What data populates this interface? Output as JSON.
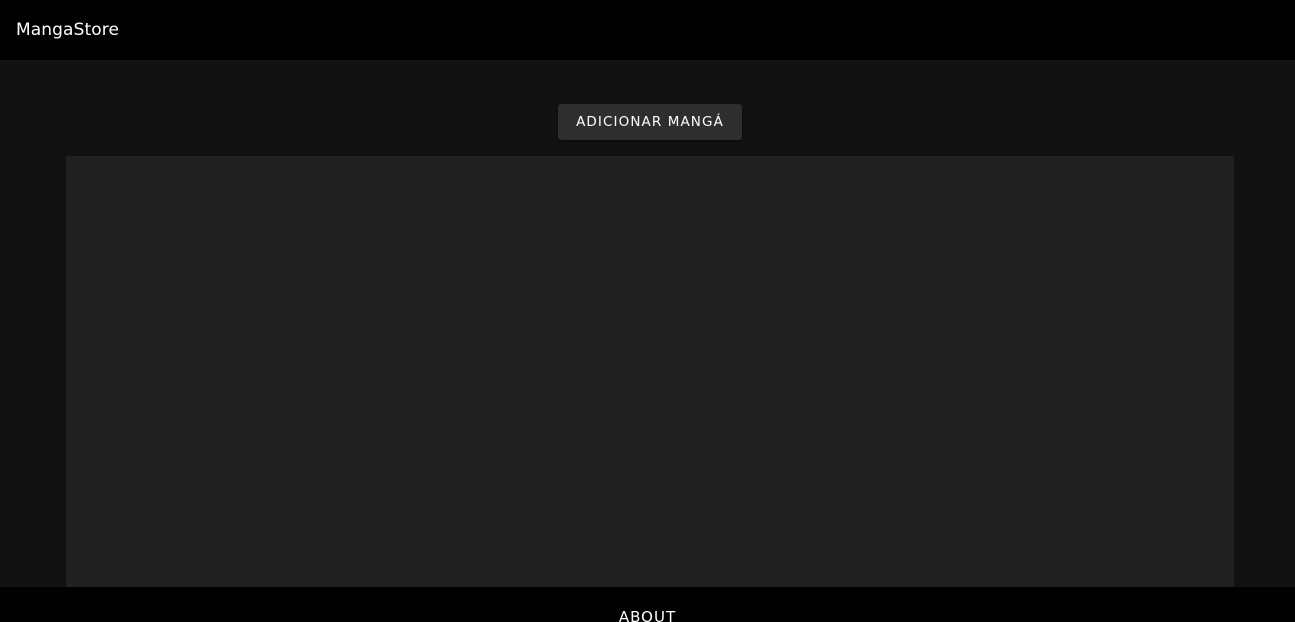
{
  "header": {
    "brand": "MangaStore"
  },
  "main": {
    "add_button_label": "ADICIONAR MANGÁ"
  },
  "footer": {
    "about_label": "ABOUT"
  },
  "colors": {
    "header_bg": "#000000",
    "page_bg": "#121212",
    "panel_bg": "#212121",
    "button_bg": "#2e2e2e",
    "text": "#ffffff"
  }
}
